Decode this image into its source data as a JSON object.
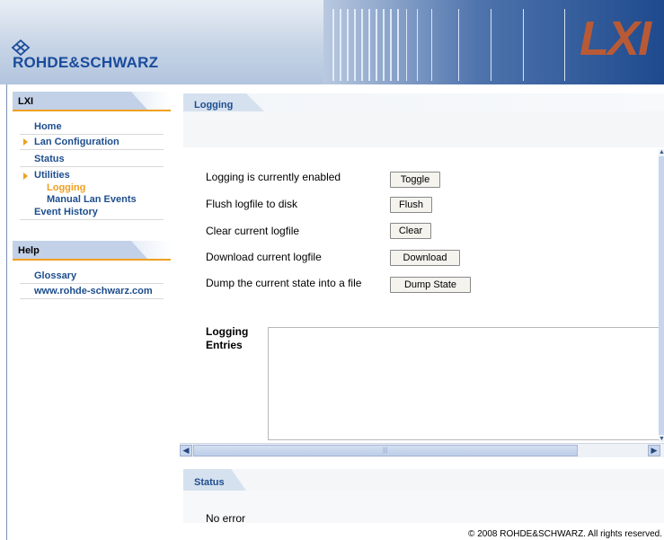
{
  "header": {
    "brand": "ROHDE&SCHWARZ",
    "lxi_logo": "LXI"
  },
  "sidebar": {
    "section_lxi": "LXI",
    "section_help": "Help",
    "items": [
      {
        "label": "Home"
      },
      {
        "label": "Lan Configuration"
      },
      {
        "label": "Status"
      },
      {
        "label": "Utilities"
      },
      {
        "label": "Logging"
      },
      {
        "label": "Manual Lan Events"
      },
      {
        "label": "Event History"
      }
    ],
    "help_items": [
      {
        "label": "Glossary"
      },
      {
        "label": "www.rohde-schwarz.com"
      }
    ]
  },
  "content": {
    "tab_label": "Logging",
    "rows": [
      {
        "label": "Logging is currently enabled",
        "button": "Toggle"
      },
      {
        "label": "Flush logfile to disk",
        "button": "Flush"
      },
      {
        "label": "Clear current logfile",
        "button": "Clear"
      },
      {
        "label": "Download current logfile",
        "button": "Download"
      },
      {
        "label": "Dump the current state into a file",
        "button": "Dump State"
      }
    ],
    "entries_label_line1": "Logging",
    "entries_label_line2": "Entries"
  },
  "status": {
    "tab_label": "Status",
    "message": "No error"
  },
  "footer": {
    "copyright": "© 2008 ROHDE&SCHWARZ. All rights reserved."
  },
  "colors": {
    "brand_blue": "#1a4c9c",
    "link_blue": "#1d4e8e",
    "accent_orange": "#f0a020",
    "lxi_red": "#b85a36"
  }
}
